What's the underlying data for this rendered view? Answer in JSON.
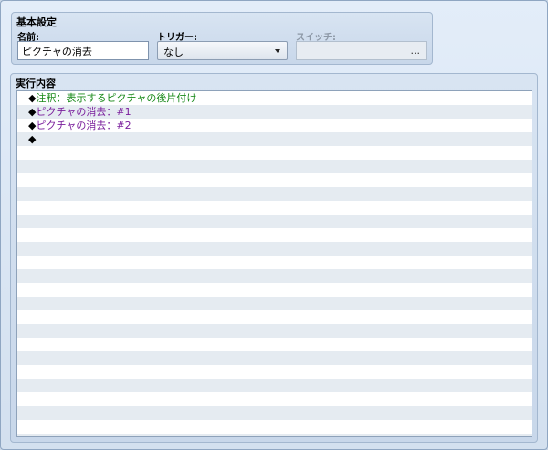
{
  "basic_settings": {
    "title": "基本設定",
    "name_label": "名前:",
    "name_value": "ピクチャの消去",
    "trigger_label": "トリガー:",
    "trigger_value": "なし",
    "switch_label": "スイッチ:",
    "switch_button": "..."
  },
  "contents": {
    "title": "実行内容",
    "commands": [
      {
        "marker": "◆",
        "text": "注釈：表示するピクチャの後片付け",
        "kind": "comment"
      },
      {
        "marker": "◆",
        "text": "ピクチャの消去：#1",
        "kind": "picture"
      },
      {
        "marker": "◆",
        "text": "ピクチャの消去：#2",
        "kind": "picture"
      },
      {
        "marker": "◆",
        "text": "",
        "kind": "empty"
      }
    ],
    "colors": {
      "comment": "#1a8a1a",
      "picture": "#7a1f9c"
    }
  }
}
